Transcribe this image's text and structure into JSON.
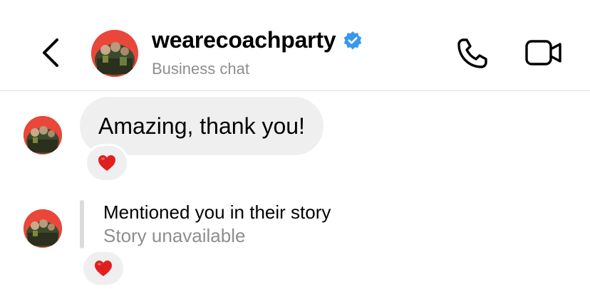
{
  "header": {
    "username": "wearecoachparty",
    "subtitle": "Business chat",
    "verified": true,
    "icons": [
      "chevron-left-icon",
      "phone-icon",
      "video-camera-icon",
      "verified-badge-icon"
    ]
  },
  "messages": [
    {
      "type": "text",
      "text": "Amazing, thank you!",
      "reaction": "❤️"
    },
    {
      "type": "story_mention",
      "title": "Mentioned you in their story",
      "status": "Story unavailable",
      "reaction": "❤️"
    }
  ],
  "colors": {
    "bubble": "#efefef",
    "secondary_text": "#8e8e8e",
    "verified": "#3897f0",
    "heart": "#e0201f",
    "avatar_bg": "#e8473a"
  }
}
